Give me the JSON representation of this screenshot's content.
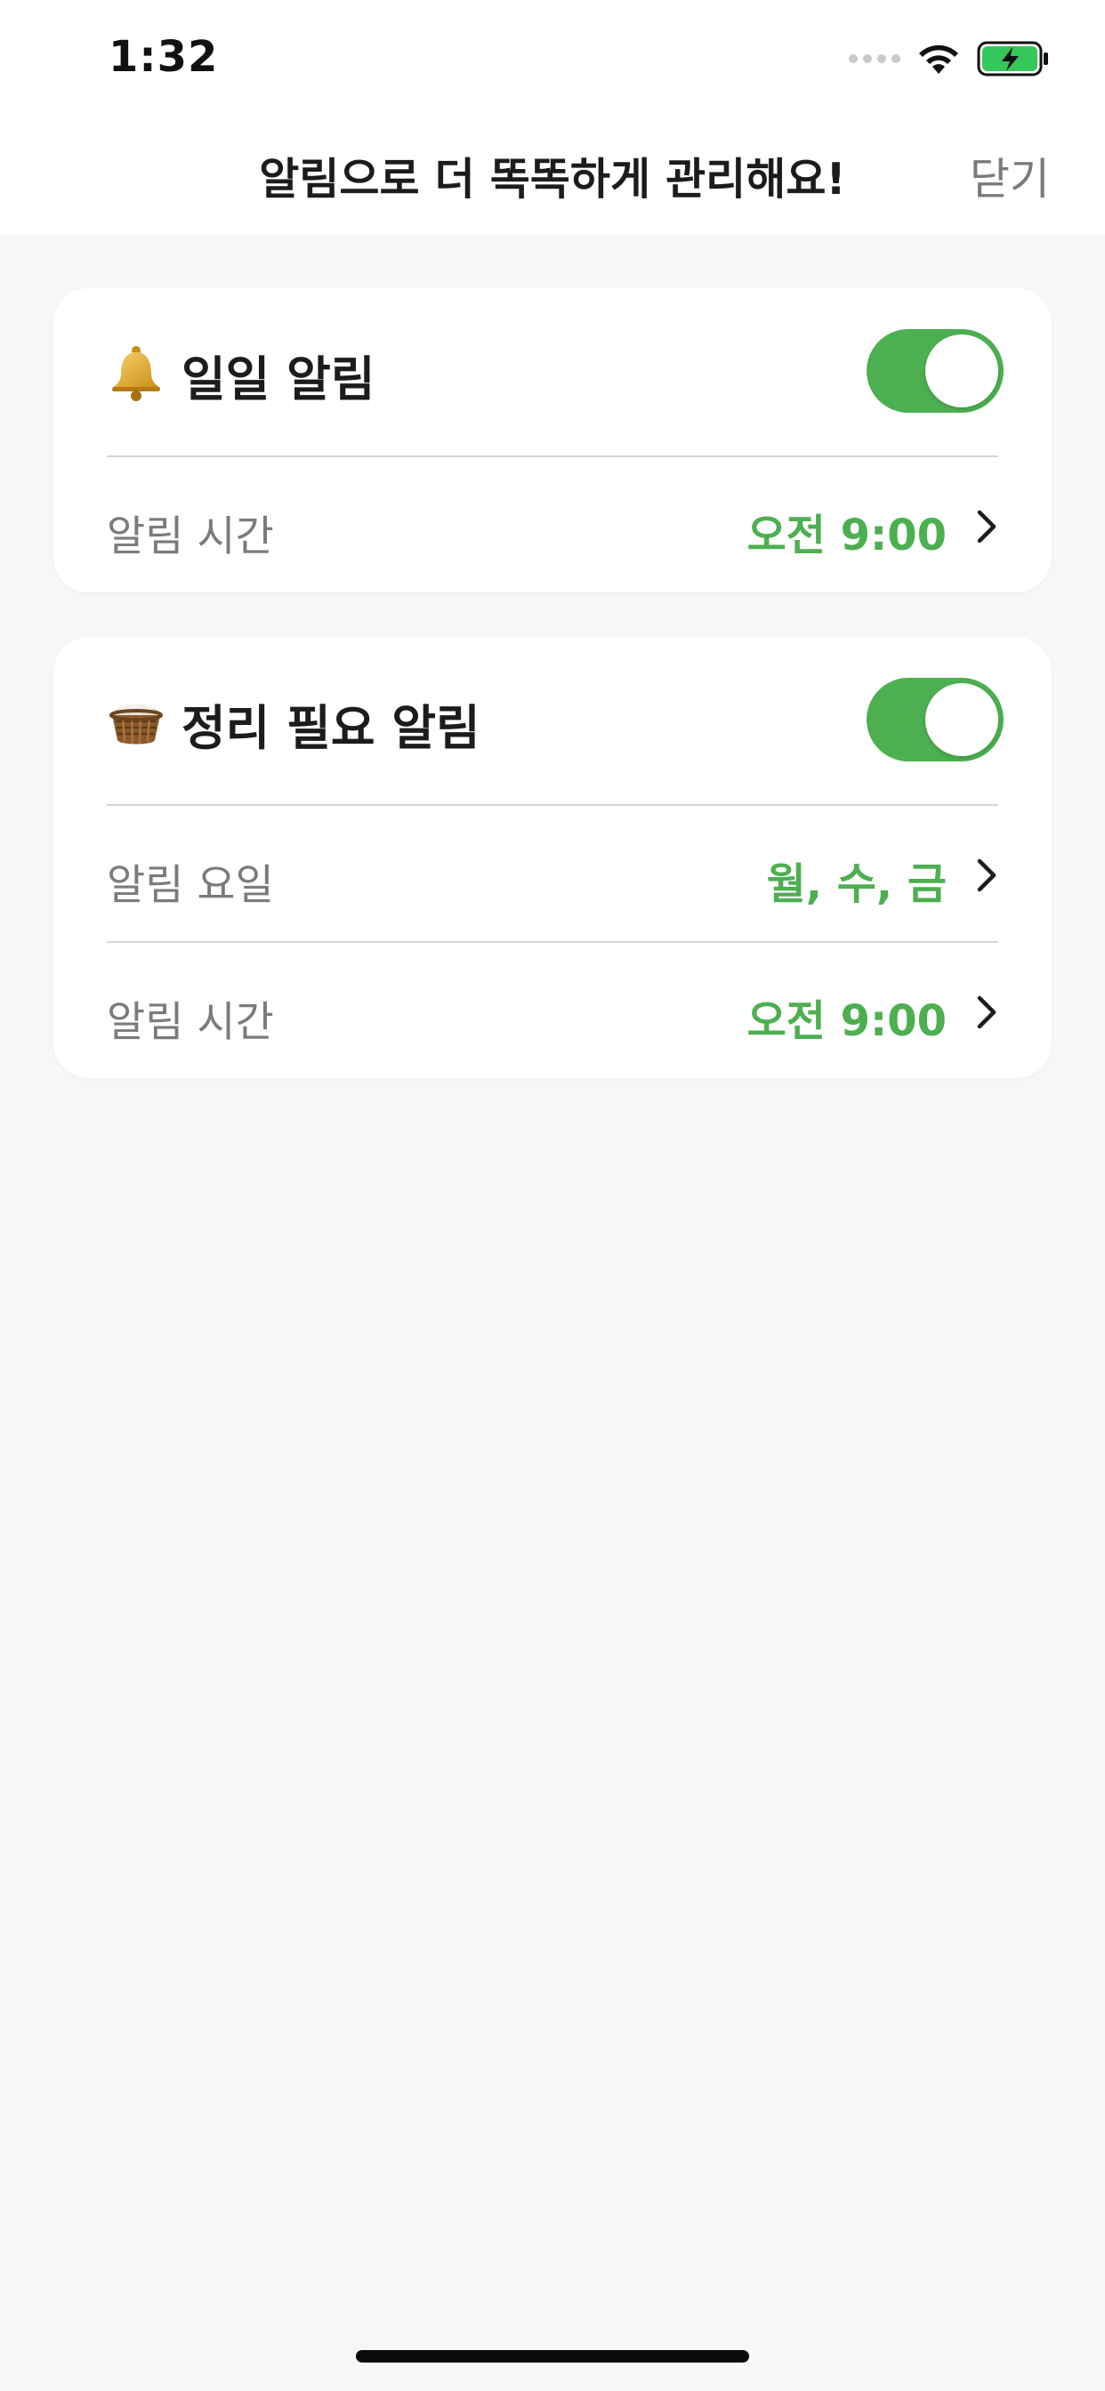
{
  "status_bar": {
    "time": "1:32",
    "icons": [
      "signal-dots-icon",
      "wifi-icon",
      "battery-charging-icon"
    ]
  },
  "header": {
    "title": "알림으로 더 똑똑하게 관리해요!",
    "close_label": "닫기"
  },
  "colors": {
    "accent": "#4caf50",
    "label_gray": "#7b7b7f",
    "background": "#f6f7f9"
  },
  "cards": [
    {
      "icon": "bell-icon",
      "title": "일일 알림",
      "toggle_on": true,
      "rows": [
        {
          "label": "알림 시간",
          "value": "오전 9:00"
        }
      ]
    },
    {
      "icon": "basket-icon",
      "title": "정리 필요 알림",
      "toggle_on": true,
      "rows": [
        {
          "label": "알림 요일",
          "value": "월, 수, 금"
        },
        {
          "label": "알림 시간",
          "value": "오전 9:00"
        }
      ]
    }
  ]
}
